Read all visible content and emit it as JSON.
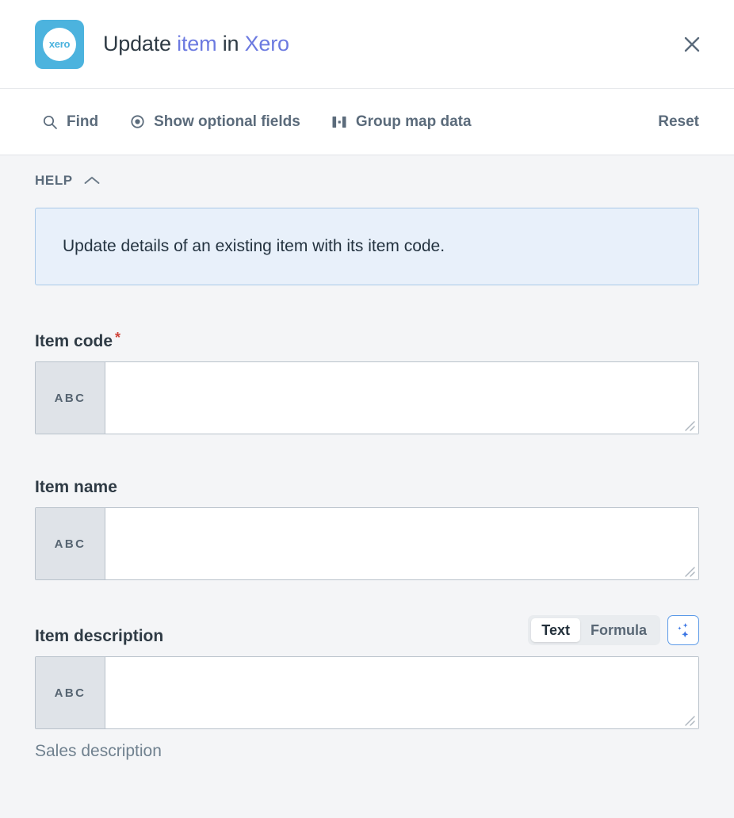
{
  "header": {
    "logo_icon": "xero-logo-icon",
    "logo_text": "xero",
    "title_prefix": "Update ",
    "title_object": "item",
    "title_middle": " in ",
    "title_app": "Xero",
    "close_icon": "close-icon",
    "brand_color": "#4cb3de",
    "accent_color": "#6c7ae0"
  },
  "toolbar": {
    "items": [
      {
        "label": "Find",
        "icon": "search-icon"
      },
      {
        "label": "Show optional fields",
        "icon": "eye-icon"
      },
      {
        "label": "Group map data",
        "icon": "group-map-data-icon"
      }
    ],
    "reset_label": "Reset"
  },
  "help": {
    "section_label": "HELP",
    "toggle_icon": "chevron-up-icon",
    "text": "Update details of an existing item with its item code.",
    "box_bg": "#e8f0fa",
    "box_border": "#a9c9e8"
  },
  "fields": [
    {
      "label": "Item code",
      "required": true,
      "required_marker": "*",
      "prefix": "ABC",
      "value": "",
      "placeholder": "",
      "helper": ""
    },
    {
      "label": "Item name",
      "required": false,
      "required_marker": "",
      "prefix": "ABC",
      "value": "",
      "placeholder": "",
      "helper": ""
    },
    {
      "label": "Item description",
      "required": false,
      "required_marker": "",
      "prefix": "ABC",
      "value": "",
      "placeholder": "",
      "helper": "Sales description"
    }
  ],
  "mode_toggle": {
    "text_label": "Text",
    "formula_label": "Formula",
    "selected": "Text",
    "ai_icon": "sparkle-ai-icon",
    "ai_border_color": "#5b9ae8"
  }
}
